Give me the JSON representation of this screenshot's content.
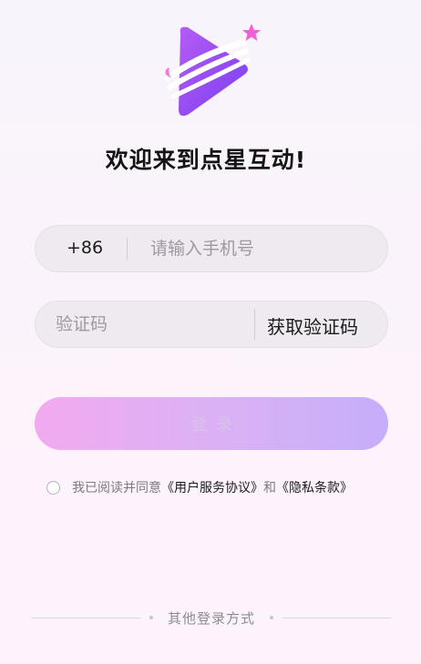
{
  "app": {
    "welcome_text": "欢迎来到点星互动!"
  },
  "login_form": {
    "country_code": "+86",
    "phone_placeholder": "请输入手机号",
    "code_placeholder": "验证码",
    "get_code_label": "获取验证码",
    "login_label": "登录"
  },
  "agreement": {
    "prefix": "我已阅读并同意",
    "user_agreement": "《用户服务协议》",
    "conjunction": "和",
    "privacy_policy": "《隐私条款》",
    "checked": false
  },
  "footer": {
    "other_login_label": "其他登录方式"
  },
  "colors": {
    "brand_purple": "#9b4df0",
    "brand_pink": "#ee5fd6",
    "button_gradient_start": "#f3aaef",
    "button_gradient_end": "#c5aefa"
  },
  "icons": {
    "logo": "shooting-star-play-logo-icon",
    "checkbox": "circle-checkbox-icon"
  }
}
